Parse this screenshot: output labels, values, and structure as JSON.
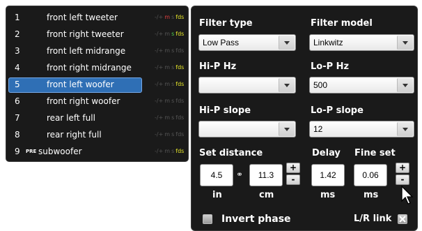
{
  "channels": [
    {
      "num": "1",
      "pre": "",
      "name": "front left tweeter",
      "flags": [
        "-/+",
        "m",
        "s",
        "fds"
      ],
      "active": {
        "m": true,
        "fds": true
      },
      "selected": false
    },
    {
      "num": "2",
      "pre": "",
      "name": "front right tweeter",
      "flags": [
        "-/+",
        "m",
        "s",
        "fds"
      ],
      "active": {
        "s": true,
        "fds": true
      },
      "selected": false
    },
    {
      "num": "3",
      "pre": "",
      "name": "front left midrange",
      "flags": [
        "-/+",
        "m",
        "s",
        "fds"
      ],
      "active": {},
      "selected": false
    },
    {
      "num": "4",
      "pre": "",
      "name": "front right midrange",
      "flags": [
        "-/+",
        "m",
        "s",
        "fds"
      ],
      "active": {
        "fds": true
      },
      "selected": false
    },
    {
      "num": "5",
      "pre": "",
      "name": "front left woofer",
      "flags": [
        "-/+",
        "m",
        "s",
        "fds"
      ],
      "active": {
        "fds": true
      },
      "selected": true
    },
    {
      "num": "6",
      "pre": "",
      "name": "front right woofer",
      "flags": [
        "-/+",
        "m",
        "s",
        "fds"
      ],
      "active": {},
      "selected": false
    },
    {
      "num": "7",
      "pre": "",
      "name": "rear left full",
      "flags": [
        "-/+",
        "m",
        "s",
        "fds"
      ],
      "active": {},
      "selected": false
    },
    {
      "num": "8",
      "pre": "",
      "name": "rear right full",
      "flags": [
        "-/+",
        "m",
        "s",
        "fds"
      ],
      "active": {},
      "selected": false
    },
    {
      "num": "9",
      "pre": "PRE",
      "name": "subwoofer",
      "flags": [
        "-/+",
        "m",
        "s",
        "fds"
      ],
      "active": {
        "fds": true
      },
      "selected": false
    }
  ],
  "filter": {
    "filter_type_label": "Filter type",
    "filter_type_value": "Low Pass",
    "filter_model_label": "Filter model",
    "filter_model_value": "Linkwitz",
    "hip_hz_label": "Hi-P Hz",
    "hip_hz_value": "",
    "lop_hz_label": "Lo-P Hz",
    "lop_hz_value": "500",
    "hip_slope_label": "Hi-P slope",
    "hip_slope_value": "",
    "lop_slope_label": "Lo-P slope",
    "lop_slope_value": "12"
  },
  "distance": {
    "label": "Set distance",
    "in_value": "4.5",
    "cm_value": "11.3",
    "in_unit": "in",
    "cm_unit": "cm",
    "plus": "+",
    "minus": "-"
  },
  "delay": {
    "label": "Delay",
    "value": "1.42",
    "unit": "ms"
  },
  "fine": {
    "label": "Fine set",
    "value": "0.06",
    "unit": "ms",
    "plus": "+",
    "minus": "-"
  },
  "invert_phase_label": "Invert phase",
  "lr_link_label": "L/R link",
  "colors": {
    "panel_bg": "#1a1a1a",
    "selection": "#2f6fb5",
    "mute_active": "#e04040",
    "solo_active": "#4ecf4e",
    "fds_active": "#e8e82a"
  }
}
